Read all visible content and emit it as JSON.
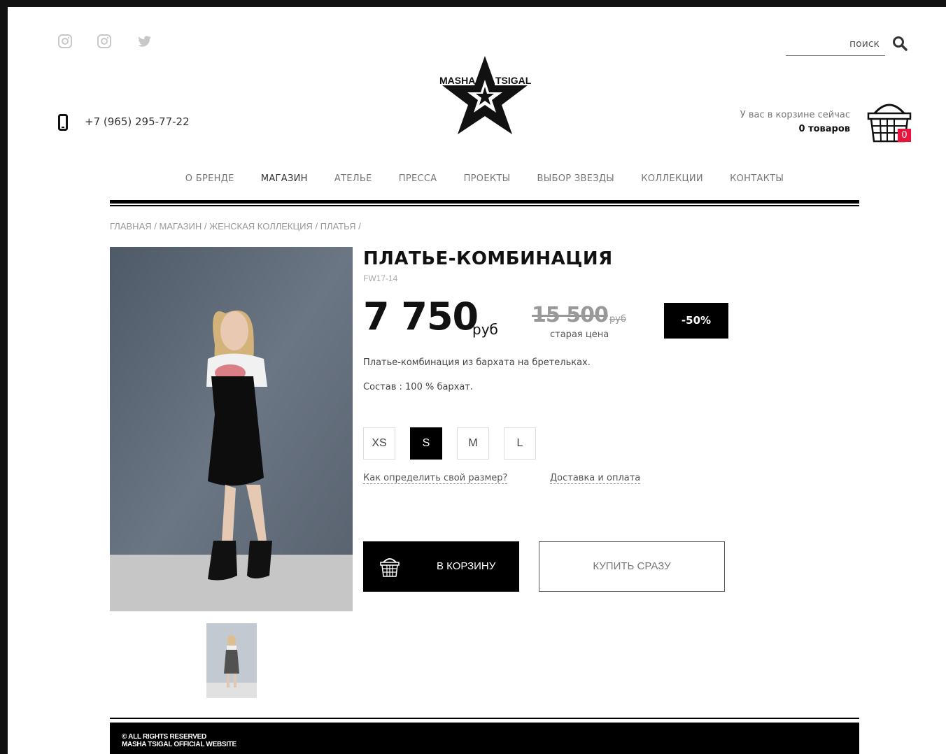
{
  "social": {
    "icons": [
      "instagram-icon",
      "instagram-icon",
      "twitter-icon"
    ]
  },
  "search": {
    "placeholder": "поиск"
  },
  "logo": {
    "text_left": "MASHA",
    "text_right": "TSIGAL"
  },
  "contact": {
    "phone": "+7 (965) 295-77-22"
  },
  "cart": {
    "status_label": "У вас в корзине сейчас",
    "items_label": "0 товаров",
    "count": "0"
  },
  "nav": {
    "items": [
      {
        "label": "О БРЕНДЕ"
      },
      {
        "label": "МАГАЗИН"
      },
      {
        "label": "АТЕЛЬЕ"
      },
      {
        "label": "ПРЕССА"
      },
      {
        "label": "ПРОЕКТЫ"
      },
      {
        "label": "ВЫБОР ЗВЕЗДЫ"
      },
      {
        "label": "КОЛЛЕКЦИИ"
      },
      {
        "label": "КОНТАКТЫ"
      }
    ],
    "active_index": 1
  },
  "breadcrumb": {
    "items": [
      "ГЛАВНАЯ",
      "МАГАЗИН",
      "ЖЕНСКАЯ КОЛЛЕКЦИЯ",
      "ПЛАТЬЯ"
    ],
    "separator": " / "
  },
  "product": {
    "title": "ПЛАТЬЕ-КОМБИНАЦИЯ",
    "sku": "FW17-14",
    "price": "7 750",
    "currency": "руб",
    "old_price": "15 500",
    "old_currency": "руб",
    "old_price_label": "старая цена",
    "discount": "-50%",
    "description": "Платье-комбинация из бархата на бретельках.",
    "composition": "Состав : 100  %  бархат.",
    "sizes": [
      "XS",
      "S",
      "M",
      "L"
    ],
    "selected_size": "S",
    "size_guide_link": "Как определить свой размер?",
    "delivery_link": "Доставка и оплата",
    "add_to_cart": "В КОРЗИНУ",
    "buy_now": "КУПИТЬ СРАЗУ"
  },
  "footer": {
    "line1": "© ALL RIGHTS RESERVED",
    "line2": "MASHA TSIGAL OFFICIAL WEBSITE"
  },
  "colors": {
    "accent_badge": "#e8143c",
    "primary": "#000000"
  }
}
